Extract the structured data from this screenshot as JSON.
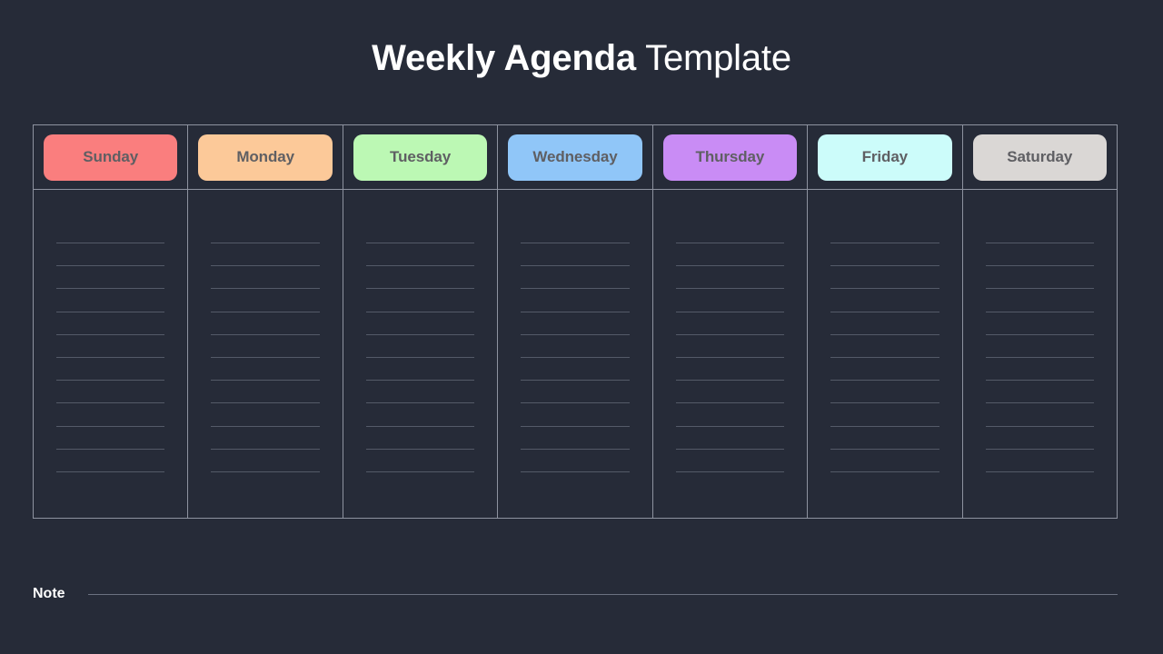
{
  "page": {
    "background_color": "#262b38",
    "title_strong": "Weekly Agenda",
    "title_light": " Template"
  },
  "agenda": {
    "border_color": "#8e93a0",
    "rule_color": "#545a68",
    "rule_count": 11,
    "pill_text_color": "#5f5f63",
    "days": [
      {
        "label": "Sunday",
        "color": "#fa7e7e"
      },
      {
        "label": "Monday",
        "color": "#fcc999"
      },
      {
        "label": "Tuesday",
        "color": "#bcf8b4"
      },
      {
        "label": "Wednesday",
        "color": "#90c6f8"
      },
      {
        "label": "Thursday",
        "color": "#c98cf5"
      },
      {
        "label": "Friday",
        "color": "#ccfcfa"
      },
      {
        "label": "Saturday",
        "color": "#dad7d5"
      }
    ]
  },
  "note": {
    "label": "Note",
    "line_color": "#6b7180"
  }
}
